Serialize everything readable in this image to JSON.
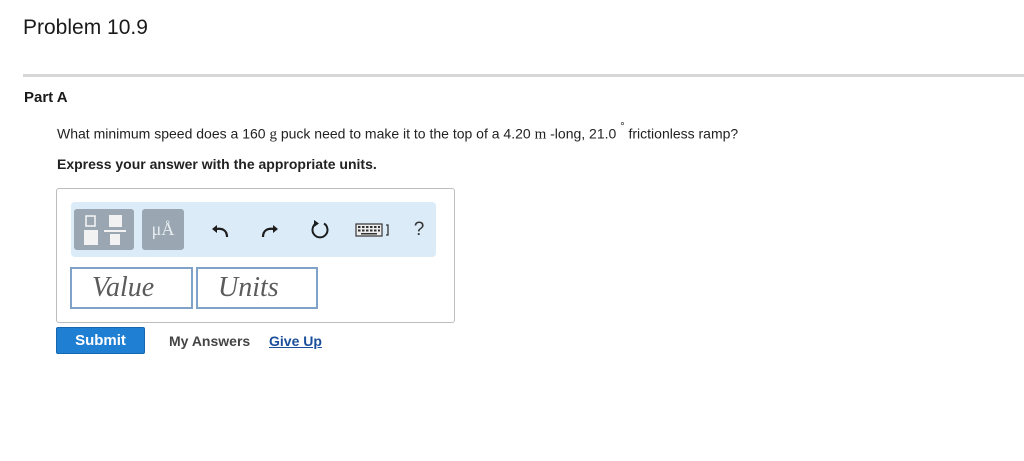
{
  "problem": {
    "title": "Problem 10.9"
  },
  "part": {
    "title": "Part A"
  },
  "question": {
    "text_1": "What minimum speed does a 160 ",
    "unit_g": "g",
    "text_2": " puck need to make it to the top of a 4.20 ",
    "unit_m": "m",
    "text_3": " -long, 21.0",
    "degree": "°",
    "text_4": " frictionless ramp?"
  },
  "instruction": "Express your answer with the appropriate units.",
  "toolbar": {
    "symbols_label": "μÅ",
    "help_label": "?",
    "icons": [
      "templates-icon",
      "symbols-icon",
      "undo-icon",
      "redo-icon",
      "reset-icon",
      "keyboard-icon",
      "help-icon"
    ]
  },
  "inputs": {
    "value_placeholder": "Value",
    "units_placeholder": "Units"
  },
  "actions": {
    "submit_label": "Submit",
    "my_answers_label": "My Answers",
    "give_up_label": "Give Up"
  },
  "colors": {
    "submit": "#1f7fd3",
    "toolbar_bg": "#dcebf8",
    "link": "#1b4e9a"
  }
}
